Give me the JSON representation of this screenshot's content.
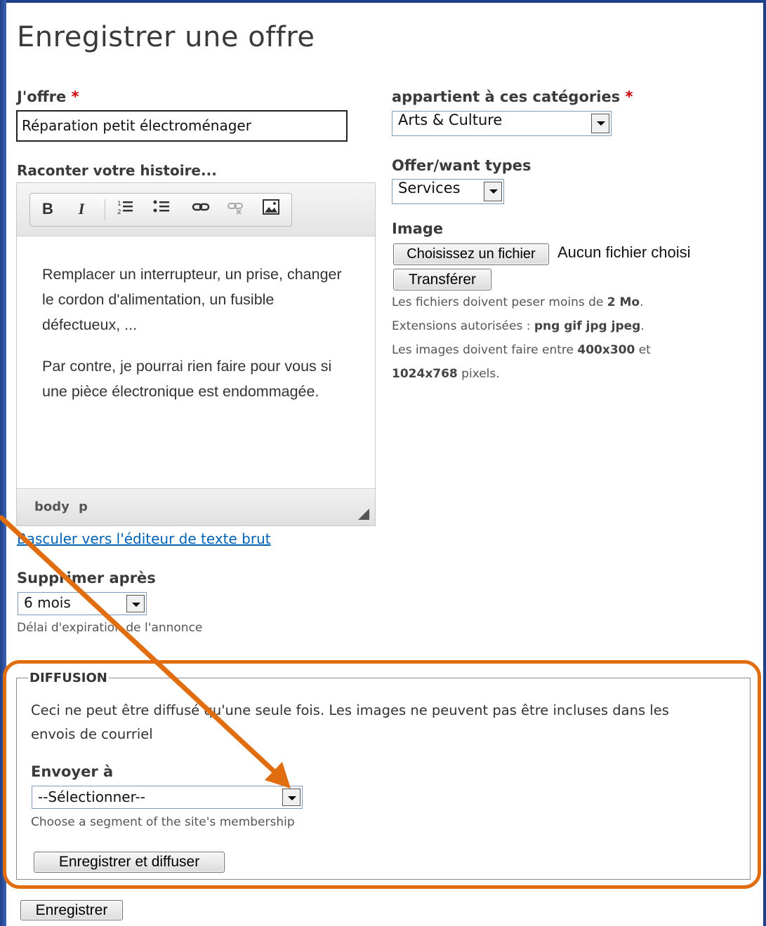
{
  "page": {
    "title": "Enregistrer une offre"
  },
  "offer": {
    "label": "J'offre",
    "required_mark": "*",
    "value": "Réparation petit électroménager"
  },
  "story": {
    "label": "Raconter votre histoire...",
    "toolbar": {
      "bold": "B",
      "italic": "I"
    },
    "paragraphs": [
      "Remplacer un interrupteur, un prise, changer le cordon d'alimentation, un fusible défectueux, ...",
      "Par contre, je pourrai rien faire pour vous si une pièce électronique est endommagée."
    ],
    "path": [
      "body",
      "p"
    ],
    "switch_link": "Basculer vers l'éditeur de texte brut"
  },
  "categories": {
    "label": "appartient à ces catégories",
    "required_mark": "*",
    "selected": "Arts & Culture"
  },
  "types": {
    "label": "Offer/want types",
    "selected": "Services"
  },
  "image": {
    "label": "Image",
    "choose_button": "Choisissez un fichier",
    "no_file": "Aucun fichier choisi",
    "upload_button": "Transférer",
    "help_size": {
      "pre": "Les fichiers doivent peser moins de ",
      "bold": "2 Mo",
      "post": "."
    },
    "help_ext": {
      "pre": "Extensions autorisées : ",
      "bold": "png gif jpg jpeg",
      "post": "."
    },
    "help_dim": {
      "pre": "Les images doivent faire entre ",
      "bold1": "400x300",
      "mid": " et",
      "bold2": "1024x768",
      "post": " pixels."
    }
  },
  "expire": {
    "label": "Supprimer après",
    "selected": "6 mois",
    "help": "Délai d'expiration de l'annonce"
  },
  "diffusion": {
    "legend": "DIFFUSION",
    "text_line1": "Ceci ne peut être diffusé qu'une seule fois. Les images ne peuvent pas être incluses dans les",
    "text_line2": "envois de courriel",
    "send_label": "Envoyer à",
    "send_selected": "--Sélectionner--",
    "send_help": "Choose a segment of the site's membership",
    "save_diffuse_button": "Enregistrer et diffuser"
  },
  "save_button": "Enregistrer",
  "colors": {
    "annotation": "#e06e10",
    "frame": "#1f3f86",
    "required": "#cc0000",
    "link": "#0061b5"
  }
}
